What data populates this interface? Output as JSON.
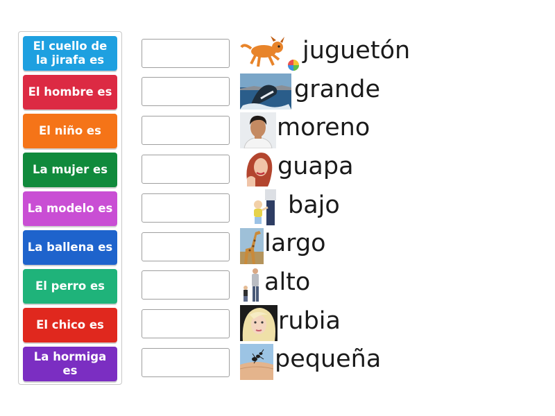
{
  "tiles": [
    {
      "label": "El cuello de la jirafa es",
      "color": "#1ea0e0"
    },
    {
      "label": "El hombre es",
      "color": "#dc2a43"
    },
    {
      "label": "El niño es",
      "color": "#f57418"
    },
    {
      "label": "La mujer es",
      "color": "#108a3c"
    },
    {
      "label": "La modelo es",
      "color": "#c94ed4"
    },
    {
      "label": "La ballena es",
      "color": "#1e63cc"
    },
    {
      "label": "El perro es",
      "color": "#1fb37a"
    },
    {
      "label": "El chico es",
      "color": "#e0281e"
    },
    {
      "label": "La hormiga es",
      "color": "#7b2ec2"
    }
  ],
  "answers": [
    {
      "word": "juguetón",
      "image": "dog-with-ball-icon"
    },
    {
      "word": "grande",
      "image": "whale-photo"
    },
    {
      "word": "moreno",
      "image": "dark-haired-man-photo"
    },
    {
      "word": "guapa",
      "image": "woman-photo"
    },
    {
      "word": "bajo",
      "image": "short-child-photo"
    },
    {
      "word": "largo",
      "image": "giraffe-photo"
    },
    {
      "word": "alto",
      "image": "tall-man-photo"
    },
    {
      "word": "rubia",
      "image": "blonde-woman-photo"
    },
    {
      "word": "pequeña",
      "image": "ant-on-finger-photo"
    }
  ]
}
